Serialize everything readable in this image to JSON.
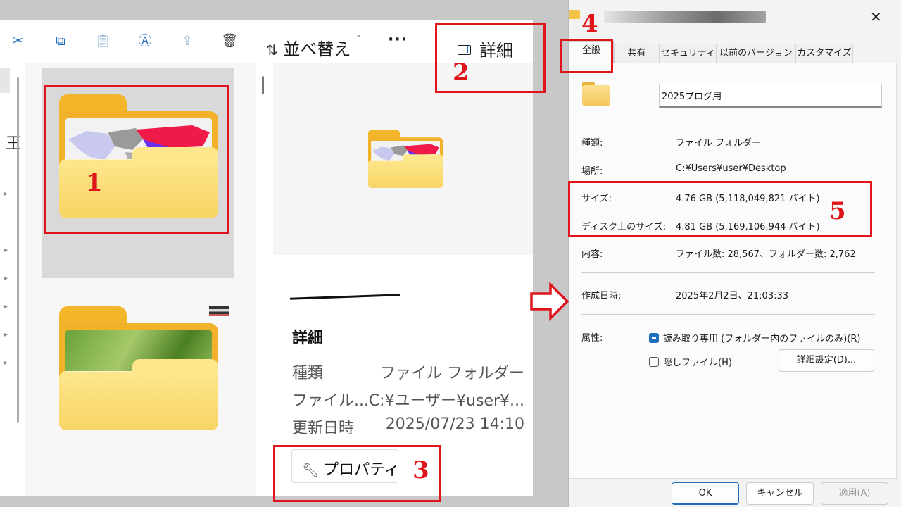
{
  "explorer": {
    "toolbar": {
      "icons": [
        "cut-icon",
        "copy-icon",
        "paste-icon",
        "rename-icon",
        "share-icon",
        "delete-icon"
      ],
      "sort_label": "並べ替え",
      "more_label": "···",
      "details_label": "詳細"
    },
    "preview": {
      "section_title": "詳細",
      "rows": [
        {
          "key": "種類",
          "value": "ファイル フォルダー"
        },
        {
          "key": "ファイル...",
          "value": "C:¥ユーザー¥user¥..."
        },
        {
          "key": "更新日時",
          "value": "2025/07/23 14:10"
        }
      ],
      "properties_label": "プロパティ"
    }
  },
  "dialog": {
    "close_label": "✕",
    "tabs": [
      "全般",
      "共有",
      "セキュリティ",
      "以前のバージョン",
      "カスタマイズ"
    ],
    "folder_name": "2025ブログ用",
    "rows": {
      "type": {
        "key": "種類:",
        "value": "ファイル フォルダー"
      },
      "location": {
        "key": "場所:",
        "value": "C:¥Users¥user¥Desktop"
      },
      "size": {
        "key": "サイズ:",
        "value": "4.76 GB (5,118,049,821 バイト)"
      },
      "disk_size": {
        "key": "ディスク上のサイズ:",
        "value": "4.81 GB (5,169,106,944 バイト)"
      },
      "contents": {
        "key": "内容:",
        "value": "ファイル数: 28,567、フォルダー数: 2,762"
      },
      "created": {
        "key": "作成日時:",
        "value": "2025年2月2日、21:03:33"
      }
    },
    "attributes": {
      "label": "属性:",
      "readonly": "読み取り専用 (フォルダー内のファイルのみ)(R)",
      "hidden": "隠しファイル(H)",
      "advanced": "詳細設定(D)..."
    },
    "buttons": {
      "ok": "OK",
      "cancel": "キャンセル",
      "apply": "適用(A)"
    }
  },
  "annotations": {
    "markers": [
      "1",
      "2",
      "3",
      "4",
      "5"
    ],
    "color": "#e0151b"
  }
}
